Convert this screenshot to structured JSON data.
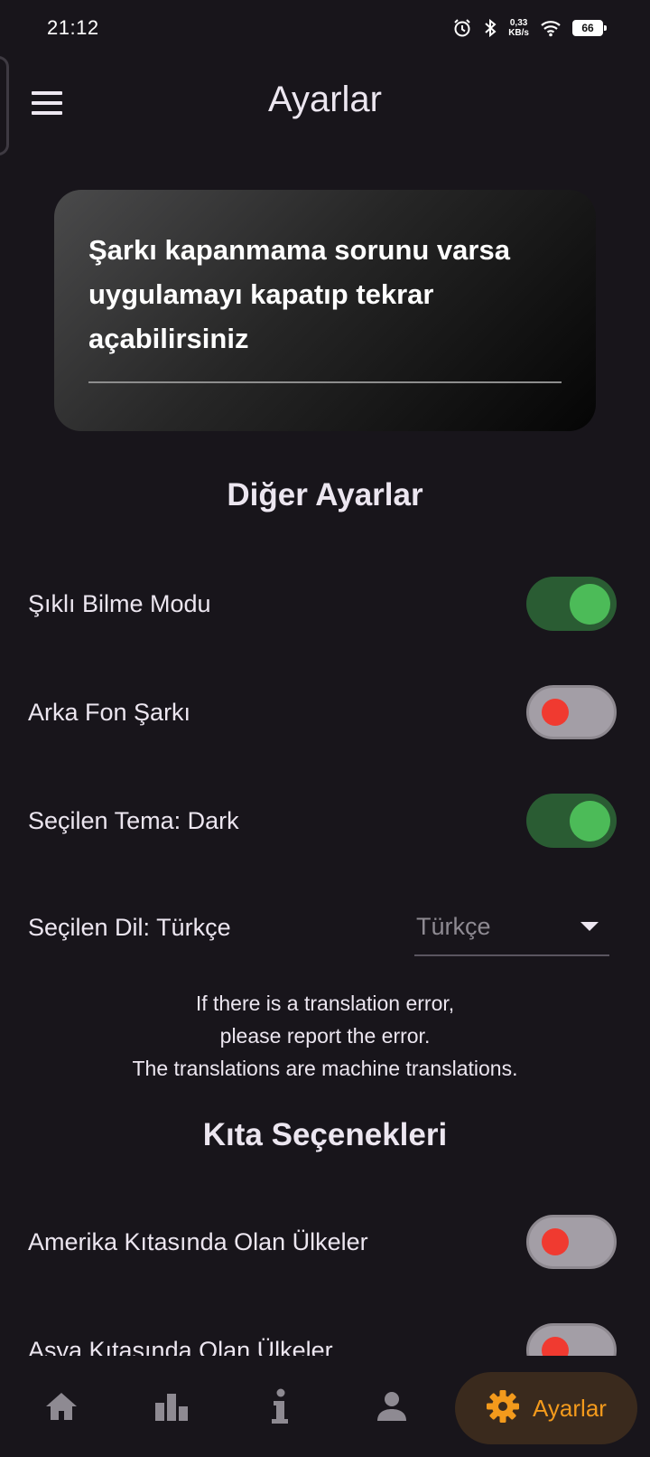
{
  "status_bar": {
    "time": "21:12",
    "net_speed_value": "0,33",
    "net_speed_unit": "KB/s",
    "battery": "66"
  },
  "app_bar": {
    "title": "Ayarlar"
  },
  "info_card": {
    "text": "Şarkı kapanmama sorunu varsa uygulamayı kapatıp tekrar açabilirsiniz"
  },
  "other_settings": {
    "heading": "Diğer Ayarlar",
    "items": [
      {
        "label": "Şıklı Bilme Modu",
        "enabled": true
      },
      {
        "label": "Arka Fon Şarkı",
        "enabled": false
      },
      {
        "label": "Seçilen Tema: Dark",
        "enabled": true
      }
    ]
  },
  "language": {
    "label": "Seçilen Dil: Türkçe",
    "selected": "Türkçe",
    "note_line1": "If there is a translation error,",
    "note_line2": "please report the error.",
    "note_line3": "The translations are machine translations."
  },
  "continents": {
    "heading": "Kıta Seçenekleri",
    "items": [
      {
        "label": "Amerika Kıtasında Olan Ülkeler",
        "enabled": false
      },
      {
        "label": "Asya Kıtasında Olan Ülkeler",
        "enabled": false
      }
    ]
  },
  "bottom_nav": {
    "items": [
      {
        "icon": "home-icon"
      },
      {
        "icon": "bar-chart-icon"
      },
      {
        "icon": "info-icon"
      },
      {
        "icon": "person-icon"
      },
      {
        "icon": "gear-icon",
        "label": "Ayarlar",
        "active": true
      }
    ],
    "active_color": "#f39a1c"
  },
  "colors": {
    "background": "#18151b",
    "toggle_on_track": "#2a5c33",
    "toggle_on_knob": "#4cbb58",
    "toggle_off_track": "#a39ea6",
    "toggle_off_knob": "#f03a30"
  }
}
